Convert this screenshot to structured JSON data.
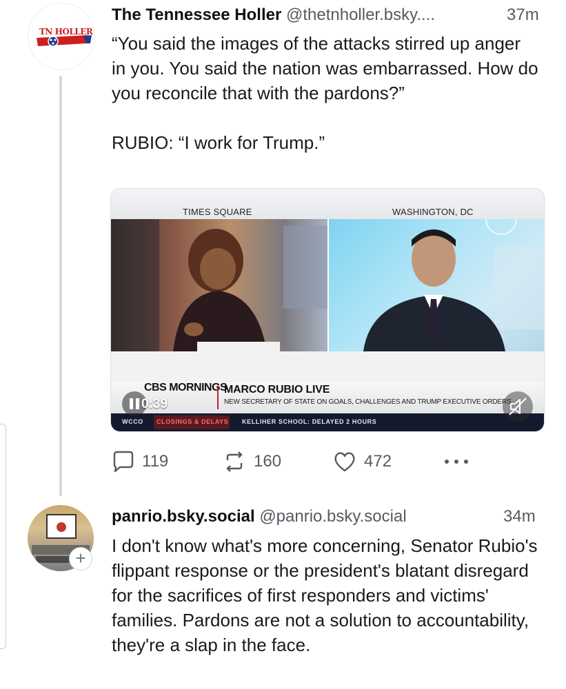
{
  "post1": {
    "author_name": "The Tennessee Holler",
    "author_handle": "@thetnholler.bsky....",
    "time": "37m",
    "avatar_logo_text": "TN HOLLER",
    "text_paragraphs": [
      "“You said the images of the attacks stirred up anger in you. You said the nation was embarrassed. How do you reconcile that with the pardons?”",
      "RUBIO: “I work for Trump.”"
    ],
    "video": {
      "location_left": "TIMES SQUARE",
      "location_right": "WASHINGTON, DC",
      "network_logo": "CBS MORNINGS",
      "headline_title": "MARCO RUBIO LIVE",
      "headline_subtitle": "NEW SECRETARY OF STATE ON GOALS, CHALLENGES AND TRUMP EXECUTIVE ORDERS",
      "ticker_station": "WCCO",
      "ticker_section": "CLOSINGS & DELAYS",
      "ticker_text": "KELLIHER SCHOOL: DELAYED 2 HOURS",
      "elapsed_time": "0:39",
      "play_state_icon": "pause-icon",
      "sound_state_icon": "muted-speaker-icon"
    },
    "actions": {
      "reply_count": "119",
      "repost_count": "160",
      "like_count": "472"
    }
  },
  "post2": {
    "author_name": "panrio.bsky.social",
    "author_handle": "@panrio.bsky.social",
    "time": "34m",
    "follow_badge_icon": "plus-icon",
    "text": "I don't know what's more concerning, Senator Rubio's flippant response or the president's blatant disregard for the sacrifices of first responders and victims' families. Pardons are not a solution to accountability, they're a slap in the face."
  },
  "colors": {
    "text_primary": "#1a1a1a",
    "text_secondary": "#555b62",
    "thread_line": "#d4d8dd",
    "brand_red": "#cc1f1f",
    "brand_blue": "#1f3a8a"
  }
}
